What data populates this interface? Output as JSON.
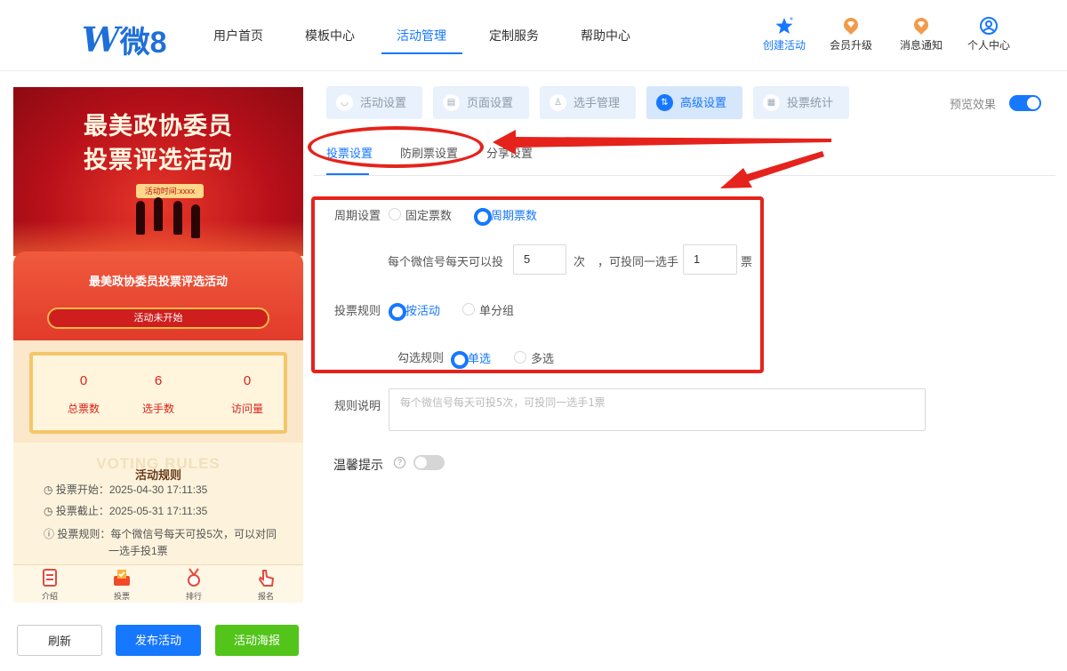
{
  "header": {
    "logo_w": "W",
    "logo_text": "微8",
    "nav": [
      "用户首页",
      "模板中心",
      "活动管理",
      "定制服务",
      "帮助中心"
    ],
    "active_nav": "活动管理",
    "actions": [
      {
        "label": "创建活动",
        "icon": "star-icon",
        "color": "#1677ff"
      },
      {
        "label": "会员升级",
        "icon": "diamond-badge-icon",
        "color": "#333333"
      },
      {
        "label": "消息通知",
        "icon": "diamond-badge-icon",
        "color": "#333333"
      },
      {
        "label": "个人中心",
        "icon": "user-circle-icon",
        "color": "#333333"
      }
    ]
  },
  "preview": {
    "banner_title_1": "最美政协委员",
    "banner_title_2": "投票评选活动",
    "banner_time": "活动时间:xxxx",
    "card_title": "最美政协委员投票评选活动",
    "status": "活动未开始",
    "stats": [
      {
        "value": "0",
        "label": "总票数"
      },
      {
        "value": "6",
        "label": "选手数"
      },
      {
        "value": "0",
        "label": "访问量"
      }
    ],
    "rules_watermark": "VOTING RULES",
    "rules_heading": "活动规则",
    "rules": [
      "投票开始：2025-04-30 17:11:35",
      "投票截止：2025-05-31 17:11:35",
      "投票规则：每个微信号每天可投5次，可以对同",
      "一选手投1票"
    ],
    "tabbar": [
      "介绍",
      "投票",
      "排行",
      "报名"
    ]
  },
  "buttons": {
    "refresh": "刷新",
    "publish": "发布活动",
    "poster": "活动海报"
  },
  "settings": {
    "tabs": [
      "活动设置",
      "页面设置",
      "选手管理",
      "高级设置",
      "投票统计"
    ],
    "active_tab": "高级设置",
    "preview_label": "预览效果",
    "preview_on": true,
    "sub_tabs": [
      "投票设置",
      "防刷票设置",
      "分享设置"
    ],
    "active_sub_tab": "投票设置",
    "cycle_label": "周期设置",
    "cycle_options": [
      "固定票数",
      "周期票数"
    ],
    "cycle_selected": "周期票数",
    "per_day_prefix": "每个微信号每天可以投",
    "per_day_value": "5",
    "times_unit": "次",
    "same_player_label": "，可投同一选手",
    "same_player_value": "1",
    "votes_unit": "票",
    "rule_label": "投票规则",
    "rule_options": [
      "按活动",
      "单分组"
    ],
    "rule_selected": "按活动",
    "check_label": "勾选规则",
    "check_options": [
      "单选",
      "多选"
    ],
    "check_selected": "单选",
    "desc_label": "规则说明",
    "desc_placeholder": "每个微信号每天可投5次，可投同一选手1票",
    "tip_label": "温馨提示",
    "tip_on": false
  },
  "colors": {
    "accent": "#1677ff",
    "annotation": "#e5231c",
    "publish_green": "#52c41a"
  }
}
